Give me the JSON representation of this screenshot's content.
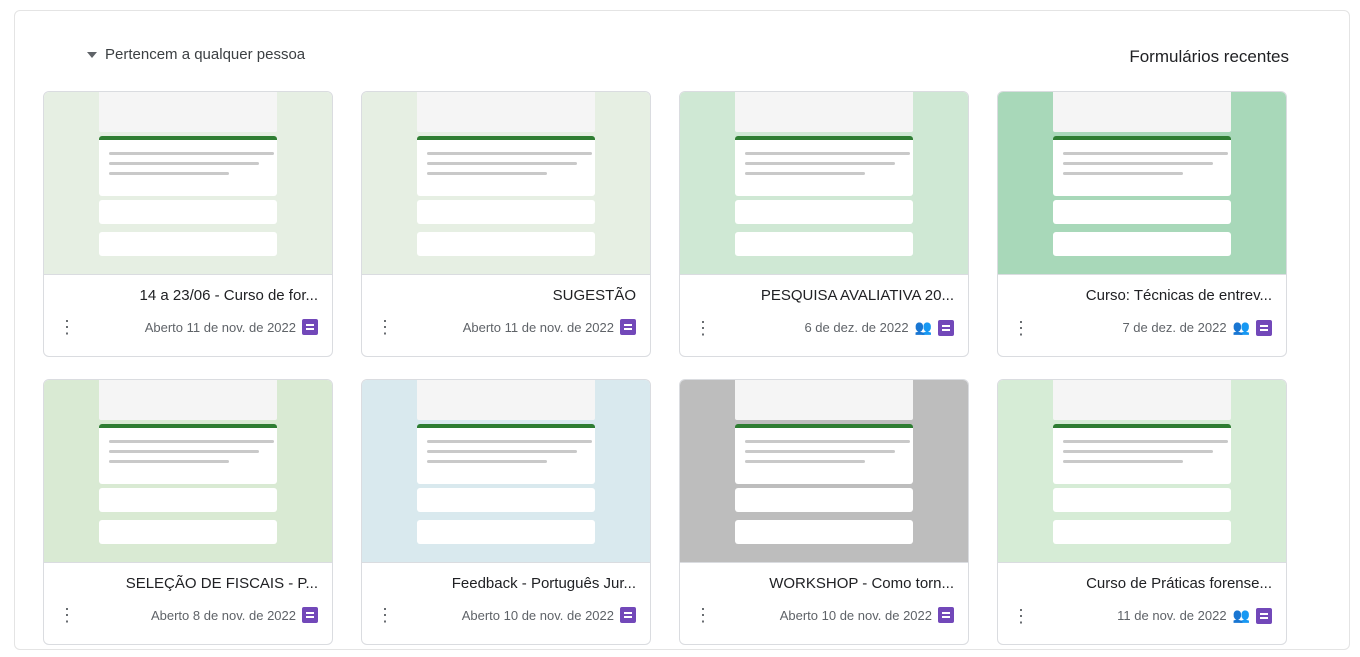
{
  "header": {
    "title": "Formulários recentes",
    "owner_filter": "Pertencem a qualquer pessoa"
  },
  "colors": {
    "forms_purple": "#7248b9",
    "green_theme": "#2e7d32"
  },
  "cards": [
    {
      "title": "Curso: Técnicas de entrev...",
      "meta": "7 de dez. de 2022",
      "shared": true,
      "menu": true,
      "theme": "#a8d8b9"
    },
    {
      "title": "PESQUISA AVALIATIVA 20...",
      "meta": "6 de dez. de 2022",
      "shared": true,
      "menu": true,
      "theme": "#cfe8d4"
    },
    {
      "title": "SUGESTÃO",
      "meta": "Aberto 11 de nov. de 2022",
      "shared": false,
      "menu": true,
      "theme": "#e6efe3"
    },
    {
      "title": "14 a 23/06 - Curso de for...",
      "meta": "Aberto 11 de nov. de 2022",
      "shared": false,
      "menu": true,
      "theme": "#e6efe3"
    },
    {
      "title": "Curso de Práticas forense...",
      "meta": "11 de nov. de 2022",
      "shared": true,
      "menu": true,
      "theme": "#d6ecd6"
    },
    {
      "title": "WORKSHOP - Como torn...",
      "meta": "Aberto 10 de nov. de 2022",
      "shared": false,
      "menu": true,
      "theme": "#bdbdbd"
    },
    {
      "title": "Feedback - Português Jur...",
      "meta": "Aberto 10 de nov. de 2022",
      "shared": false,
      "menu": true,
      "theme": "#d9e9ee"
    },
    {
      "title": "SELEÇÃO DE FISCAIS - P...",
      "meta": "Aberto 8 de nov. de 2022",
      "shared": false,
      "menu": true,
      "theme": "#d9ead3"
    }
  ]
}
